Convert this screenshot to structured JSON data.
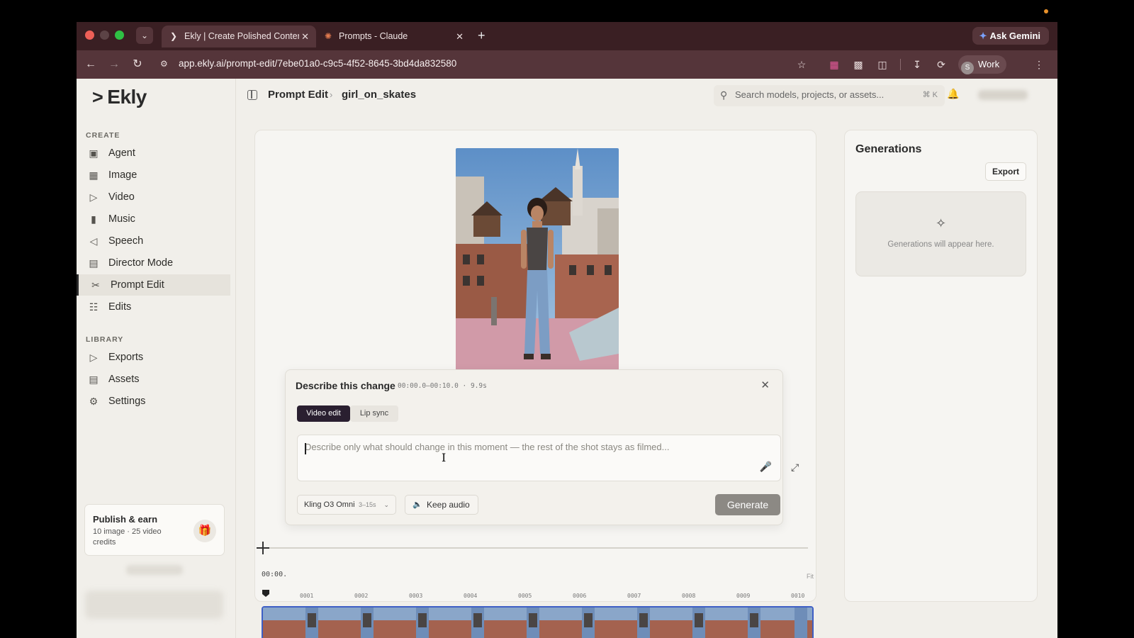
{
  "browser": {
    "tabs": [
      {
        "title": "Ekly | Create Polished Content",
        "active": true
      },
      {
        "title": "Prompts - Claude",
        "active": false
      }
    ],
    "url": "app.ekly.ai/prompt-edit/7ebe01a0-c9c5-4f52-8645-3bd4da832580",
    "gemini_label": "Ask Gemini",
    "profile_initial": "S",
    "profile_label": "Work"
  },
  "sidebar": {
    "brand": "Ekly",
    "create_heading": "CREATE",
    "create_items": [
      {
        "label": "Agent",
        "icon": "robot-icon"
      },
      {
        "label": "Image",
        "icon": "image-icon"
      },
      {
        "label": "Video",
        "icon": "video-icon"
      },
      {
        "label": "Music",
        "icon": "waveform-icon"
      },
      {
        "label": "Speech",
        "icon": "speaker-icon"
      },
      {
        "label": "Director Mode",
        "icon": "clapperboard-icon"
      },
      {
        "label": "Prompt Edit",
        "icon": "scissors-icon",
        "active": true
      },
      {
        "label": "Edits",
        "icon": "edits-icon"
      }
    ],
    "library_heading": "LIBRARY",
    "library_items": [
      {
        "label": "Exports",
        "icon": "play-icon"
      },
      {
        "label": "Assets",
        "icon": "archive-icon"
      },
      {
        "label": "Settings",
        "icon": "gear-icon"
      }
    ],
    "publish": {
      "title": "Publish & earn",
      "subtitle": "10 image · 25 video credits"
    }
  },
  "header": {
    "breadcrumb_root": "Prompt Edit",
    "breadcrumb_current": "girl_on_skates",
    "search_placeholder": "Search models, projects, or assets...",
    "search_shortcut": "⌘ K"
  },
  "dialog": {
    "title": "Describe this change",
    "range": "00:00.0–00:10.0 · 9.9s",
    "tabs": [
      "Video edit",
      "Lip sync"
    ],
    "active_tab": "Video edit",
    "placeholder": "Describe only what should change in this moment — the rest of the shot stays as filmed...",
    "model": "Kling O3 Omni",
    "model_duration": "3–15s",
    "keep_audio": "Keep audio",
    "generate": "Generate"
  },
  "timeline": {
    "timecode": "00:00.",
    "fit_label": "Fit",
    "ruler": [
      "0001",
      "0002",
      "0003",
      "0004",
      "0005",
      "0006",
      "0007",
      "0008",
      "0009",
      "0010"
    ]
  },
  "generations": {
    "title": "Generations",
    "export_label": "Export",
    "empty_text": "Generations will appear here."
  }
}
